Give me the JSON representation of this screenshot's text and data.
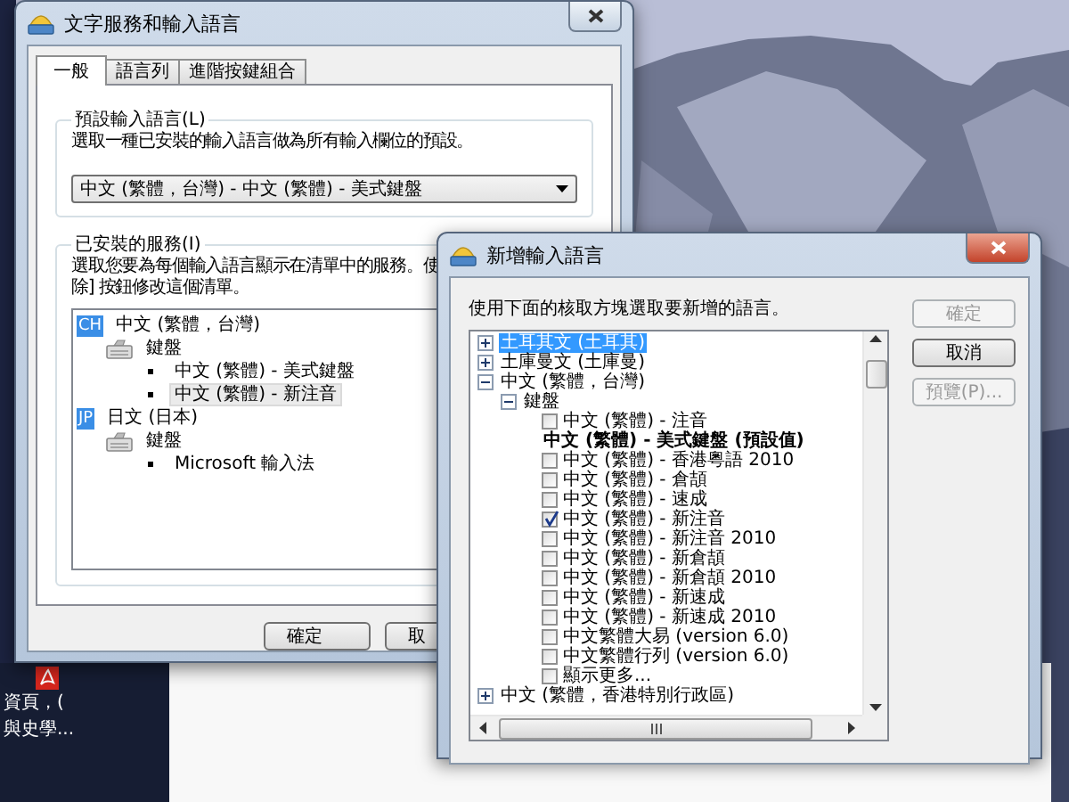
{
  "desktop_thumbnail": {
    "lines": [
      "資頁，(",
      "與史學..."
    ]
  },
  "main_window": {
    "title": "文字服務和輸入語言",
    "tabs": [
      {
        "label": "一般",
        "selected": true
      },
      {
        "label": "語言列",
        "selected": false
      },
      {
        "label": "進階按鍵組合",
        "selected": false
      }
    ],
    "default_group": {
      "title": "預設輸入語言(L)",
      "description": "選取一種已安裝的輸入語言做為所有輸入欄位的預設。",
      "dropdown_value": "中文 (繁體，台灣) - 中文 (繁體) - 美式鍵盤"
    },
    "services_group": {
      "title": "已安裝的服務(I)",
      "description_lines": [
        "選取您要為每個輸入語言顯示在清單中的服務。使",
        "除] 按鈕修改這個清單。"
      ],
      "tree": [
        {
          "kind": "language",
          "badge": "CH",
          "label": "中文 (繁體，台灣)",
          "selected": false,
          "children": [
            {
              "kind": "category",
              "label": "鍵盤",
              "selected": false,
              "children": [
                {
                  "kind": "service",
                  "label": "中文 (繁體) - 美式鍵盤",
                  "selected": false
                },
                {
                  "kind": "service",
                  "label": "中文 (繁體) - 新注音",
                  "selected": true
                }
              ]
            }
          ]
        },
        {
          "kind": "language",
          "badge": "JP",
          "label": "日文 (日本)",
          "selected": false,
          "children": [
            {
              "kind": "category",
              "label": "鍵盤",
              "selected": false,
              "children": [
                {
                  "kind": "service",
                  "label": "Microsoft 輸入法",
                  "selected": false
                }
              ]
            }
          ]
        }
      ]
    },
    "buttons": [
      {
        "label": "確定",
        "disabled": false
      },
      {
        "label": "取",
        "disabled": false
      }
    ]
  },
  "add_dialog": {
    "title": "新增輸入語言",
    "instruction": "使用下面的核取方塊選取要新增的語言。",
    "tree": [
      {
        "kind": "node",
        "label": "土耳其文 (土耳其)",
        "expanded": false,
        "selected": true
      },
      {
        "kind": "node",
        "label": "土庫曼文 (土庫曼)",
        "expanded": false,
        "selected": false
      },
      {
        "kind": "node",
        "label": "中文 (繁體，台灣)",
        "expanded": true,
        "selected": false,
        "children": [
          {
            "kind": "node",
            "label": "鍵盤",
            "expanded": true,
            "selected": false,
            "children": [
              {
                "kind": "checkbox",
                "label": "中文 (繁體) - 注音",
                "checked": false,
                "selected": false
              },
              {
                "kind": "default",
                "label": "中文 (繁體) - 美式鍵盤 (預設值)",
                "selected": false
              },
              {
                "kind": "checkbox",
                "label": "中文 (繁體) - 香港粵語 2010",
                "checked": false,
                "selected": false
              },
              {
                "kind": "checkbox",
                "label": "中文 (繁體) - 倉頡",
                "checked": false,
                "selected": false
              },
              {
                "kind": "checkbox",
                "label": "中文 (繁體) - 速成",
                "checked": false,
                "selected": false
              },
              {
                "kind": "checkbox",
                "label": "中文 (繁體) - 新注音",
                "checked": true,
                "selected": false
              },
              {
                "kind": "checkbox",
                "label": "中文 (繁體) - 新注音 2010",
                "checked": false,
                "selected": false
              },
              {
                "kind": "checkbox",
                "label": "中文 (繁體) - 新倉頡",
                "checked": false,
                "selected": false
              },
              {
                "kind": "checkbox",
                "label": "中文 (繁體) - 新倉頡 2010",
                "checked": false,
                "selected": false
              },
              {
                "kind": "checkbox",
                "label": "中文 (繁體) - 新速成",
                "checked": false,
                "selected": false
              },
              {
                "kind": "checkbox",
                "label": "中文 (繁體) - 新速成 2010",
                "checked": false,
                "selected": false
              },
              {
                "kind": "checkbox",
                "label": "中文繁體大易 (version 6.0)",
                "checked": false,
                "selected": false
              },
              {
                "kind": "checkbox",
                "label": "中文繁體行列 (version 6.0)",
                "checked": false,
                "selected": false
              },
              {
                "kind": "checkbox",
                "label": "顯示更多...",
                "checked": false,
                "selected": false
              }
            ]
          }
        ]
      },
      {
        "kind": "node",
        "label": "中文 (繁體，香港特別行政區)",
        "expanded": false,
        "selected": false
      }
    ],
    "buttons": [
      {
        "label": "確定",
        "disabled": true
      },
      {
        "label": "取消",
        "disabled": false
      },
      {
        "label": "預覽(P)...",
        "disabled": true
      }
    ]
  }
}
